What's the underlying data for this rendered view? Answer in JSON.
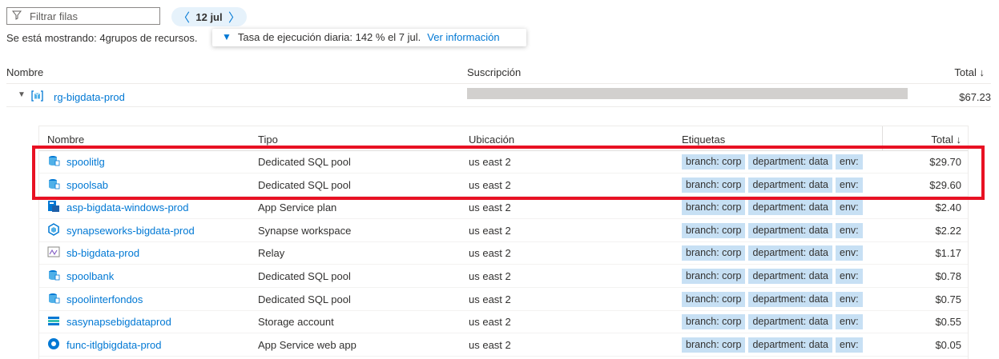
{
  "toolbar": {
    "filter_placeholder": "Filtrar filas",
    "date_label": "12 jul",
    "prev_icon": "chevron-left-icon",
    "next_icon": "chevron-right-icon",
    "filter_icon": "funnel-icon"
  },
  "summary": {
    "showing_text": "Se está mostrando: 4grupos de recursos.",
    "callout_text": "Tasa de ejecución diaria: 142 % el 7 jul.",
    "callout_link": "Ver información"
  },
  "outer_table": {
    "headers": {
      "name": "Nombre",
      "subscription": "Suscripción",
      "total": "Total ↓"
    },
    "group": {
      "name": "rg-bigdata-prod",
      "total": "$67.23",
      "icon": "resource-group-icon"
    }
  },
  "inner_table": {
    "headers": {
      "name": "Nombre",
      "type": "Tipo",
      "location": "Ubicación",
      "tags": "Etiquetas",
      "total": "Total ↓"
    },
    "rows": [
      {
        "name": "spoolitlg",
        "type": "Dedicated SQL pool",
        "location": "us east 2",
        "tags": [
          "branch: corp",
          "department: data",
          "env:"
        ],
        "total": "$29.70",
        "icon": "sql-pool-icon"
      },
      {
        "name": "spoolsab",
        "type": "Dedicated SQL pool",
        "location": "us east 2",
        "tags": [
          "branch: corp",
          "department: data",
          "env:"
        ],
        "total": "$29.60",
        "icon": "sql-pool-icon"
      },
      {
        "name": "asp-bigdata-windows-prod",
        "type": "App Service plan",
        "location": "us east 2",
        "tags": [
          "branch: corp",
          "department: data",
          "env:"
        ],
        "total": "$2.40",
        "icon": "app-service-plan-icon"
      },
      {
        "name": "synapseworks-bigdata-prod",
        "type": "Synapse workspace",
        "location": "us east 2",
        "tags": [
          "branch: corp",
          "department: data",
          "env:"
        ],
        "total": "$2.22",
        "icon": "synapse-icon"
      },
      {
        "name": "sb-bigdata-prod",
        "type": "Relay",
        "location": "us east 2",
        "tags": [
          "branch: corp",
          "department: data",
          "env:"
        ],
        "total": "$1.17",
        "icon": "relay-icon"
      },
      {
        "name": "spoolbank",
        "type": "Dedicated SQL pool",
        "location": "us east 2",
        "tags": [
          "branch: corp",
          "department: data",
          "env:"
        ],
        "total": "$0.78",
        "icon": "sql-pool-icon"
      },
      {
        "name": "spoolinterfondos",
        "type": "Dedicated SQL pool",
        "location": "us east 2",
        "tags": [
          "branch: corp",
          "department: data",
          "env:"
        ],
        "total": "$0.75",
        "icon": "sql-pool-icon"
      },
      {
        "name": "sasynapsebigdataprod",
        "type": "Storage account",
        "location": "us east 2",
        "tags": [
          "branch: corp",
          "department: data",
          "env:"
        ],
        "total": "$0.55",
        "icon": "storage-account-icon"
      },
      {
        "name": "func-itlgbigdata-prod",
        "type": "App Service web app",
        "location": "us east 2",
        "tags": [
          "branch: corp",
          "department: data",
          "env:"
        ],
        "total": "$0.05",
        "icon": "web-app-icon"
      }
    ]
  },
  "colors": {
    "accent": "#0078d4",
    "tag_bg": "#c7e0f4",
    "highlight": "#e81123"
  }
}
